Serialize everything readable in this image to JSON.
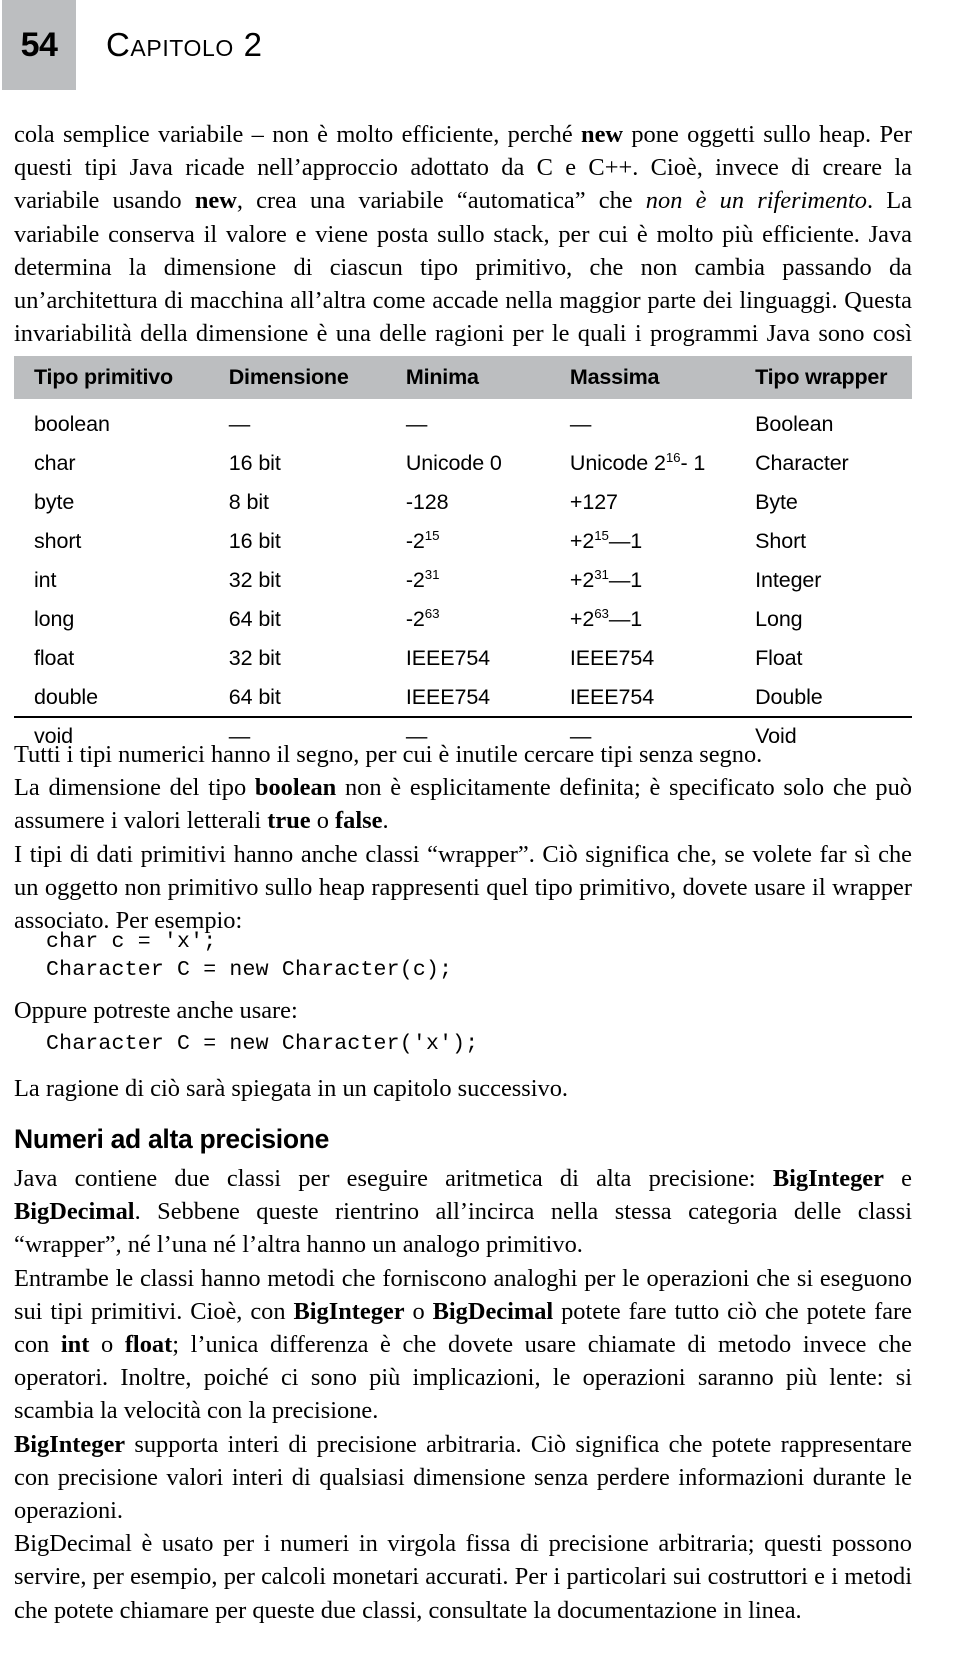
{
  "page": {
    "folio": "54",
    "chapter_title": "Capitolo 2"
  },
  "intro_paragraph": {
    "l1_a": "cola semplice variabile – non è molto efficiente, perché ",
    "l1_b": "new",
    "l1_c": " pone oggetti sullo heap. Per questi tipi Java ricade nell’approccio adottato da C e C++. Cioè, invece di creare la variabile usando ",
    "l2_b": "new",
    "l2_c": ", crea una variabile “automatica” che ",
    "l2_i": "non è un riferimento",
    "l3_c": ". La variabile conserva il valore e viene posta sullo stack, per cui è molto più efficiente. Java determina la dimensione di ciascun tipo primitivo, che non cambia passando da un’architettura di macchina all’altra come accade nella maggior parte dei linguaggi. Questa invariabilità della dimensione è una delle ragioni per le quali i programmi Java sono così portabili."
  },
  "table": {
    "headers": [
      "Tipo primitivo",
      "Dimensione",
      "Minima",
      "Massima",
      "Tipo wrapper"
    ],
    "rows": [
      {
        "tipo": "boolean",
        "dimensione": "—",
        "minima": "—",
        "massima": "—",
        "wrapper": "Boolean"
      },
      {
        "tipo": "char",
        "dimensione": "16 bit",
        "minima": "Unicode 0",
        "massima_pre": "Unicode 2",
        "massima_sup": "16",
        "massima_post": "- 1",
        "wrapper": "Character"
      },
      {
        "tipo": "byte",
        "dimensione": "8 bit",
        "minima": "-128",
        "massima": "+127",
        "wrapper": "Byte"
      },
      {
        "tipo": "short",
        "dimensione": "16 bit",
        "minima_pre": "-2",
        "minima_sup": "15",
        "massima_pre": "+2",
        "massima_sup": "15",
        "massima_post": "—1",
        "wrapper": "Short"
      },
      {
        "tipo": "int",
        "dimensione": "32 bit",
        "minima_pre": "-2",
        "minima_sup": "31",
        "massima_pre": "+2",
        "massima_sup": "31",
        "massima_post": "—1",
        "wrapper": "Integer"
      },
      {
        "tipo": "long",
        "dimensione": "64 bit",
        "minima_pre": "-2",
        "minima_sup": "63",
        "massima_pre": "+2",
        "massima_sup": "63",
        "massima_post": "—1",
        "wrapper": "Long"
      },
      {
        "tipo": "float",
        "dimensione": "32 bit",
        "minima": "IEEE754",
        "massima": "IEEE754",
        "wrapper": "Float"
      },
      {
        "tipo": "double",
        "dimensione": "64 bit",
        "minima": "IEEE754",
        "massima": "IEEE754",
        "wrapper": "Double"
      },
      {
        "tipo": "void",
        "dimensione": "—",
        "minima": "—",
        "massima": "—",
        "wrapper": "Void"
      }
    ]
  },
  "after_table": {
    "p1": "Tutti i tipi numerici hanno il segno, per cui è inutile cercare tipi senza segno.",
    "p2_a": "La dimensione del tipo ",
    "p2_b": "boolean",
    "p2_c": " non è esplicitamente definita; è specificato solo che può assumere i valori letterali ",
    "p2_d": "true",
    "p2_e": " o ",
    "p2_f": "false",
    "p2_g": ".",
    "p3": "I tipi di dati primitivi hanno anche classi “wrapper”. Ciò significa che, se volete far sì che un oggetto non primitivo sullo heap rappresenti quel tipo primitivo, dovete usare il wrapper associato. Per esempio:"
  },
  "code_block_1": "char c = 'x';\nCharacter C = new Character(c);",
  "oppure_line": "Oppure potreste anche usare:",
  "code_block_2": "Character C = new Character('x');",
  "ragione_line": "La ragione di ciò sarà spiegata in un capitolo successivo.",
  "section": {
    "heading": "Numeri ad alta precisione",
    "p1_a": "Java contiene due classi per eseguire aritmetica di alta precisione: ",
    "p1_b": "BigInteger",
    "p1_c": " e ",
    "p1_d": "BigDecimal",
    "p1_e": ". Sebbene queste rientrino all’incirca nella stessa categoria delle classi “wrapper”, né l’una né l’altra hanno un analogo primitivo.",
    "p2_a": "Entrambe le classi hanno metodi che forniscono analoghi per le operazioni che si eseguono sui tipi primitivi. Cioè, con ",
    "p2_b": "BigInteger",
    "p2_c": " o ",
    "p2_d": "BigDecimal",
    "p2_e": " potete fare tutto ciò che potete fare con ",
    "p2_f": "int",
    "p2_g": " o ",
    "p2_h": "float",
    "p2_i": "; l’unica differenza è che dovete usare chiamate di metodo invece che operatori. Inoltre, poiché ci sono più implicazioni, le operazioni saranno più lente: si scambia la velocità con la precisione.",
    "p3_a": "BigInteger",
    "p3_b": " supporta interi di precisione arbitraria. Ciò significa che potete rappresentare con precisione valori interi di qualsiasi dimensione senza perdere informazioni durante le operazioni.",
    "p4": "BigDecimal è usato per i numeri in virgola fissa di precisione arbitraria; questi possono servire, per esempio, per calcoli monetari accurati. Per i particolari sui costruttori e i metodi che potete chiamare per queste due classi, consultate la documentazione in linea."
  },
  "colors": {
    "header_gray": "#bcbec0",
    "text": "#000000",
    "background": "#ffffff"
  }
}
